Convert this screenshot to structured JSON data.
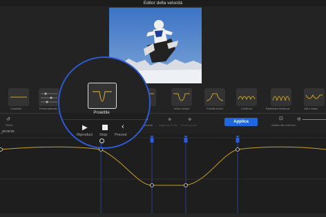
{
  "window": {
    "title": "Editor della velocità"
  },
  "presets": [
    {
      "label": "Costante"
    },
    {
      "label": "Personalizzato"
    },
    {
      "label": "Proiettile"
    },
    {
      "label": "InOut veloce"
    },
    {
      "label": "Facilità InOut"
    },
    {
      "label": "Continuo"
    },
    {
      "label": "Rallentare lentezza"
    },
    {
      "label": "Alti e bassi"
    }
  ],
  "toolbar": {
    "reset_label": "Reset",
    "time_label": "00:00:05",
    "play_label": "Riproduci",
    "stop_label": "Stop",
    "prev_label": "Preced",
    "keyframe_label": "Keyframe",
    "add_point_label": "Aggiungi Punto",
    "delete_label": "Elimina punto",
    "apply_label": "Applica",
    "fit_label": "Adatta allo schermo"
  },
  "colors": {
    "accent": "#1f67e0",
    "curve": "#c9a227",
    "highlight": "#2e5bd6"
  }
}
